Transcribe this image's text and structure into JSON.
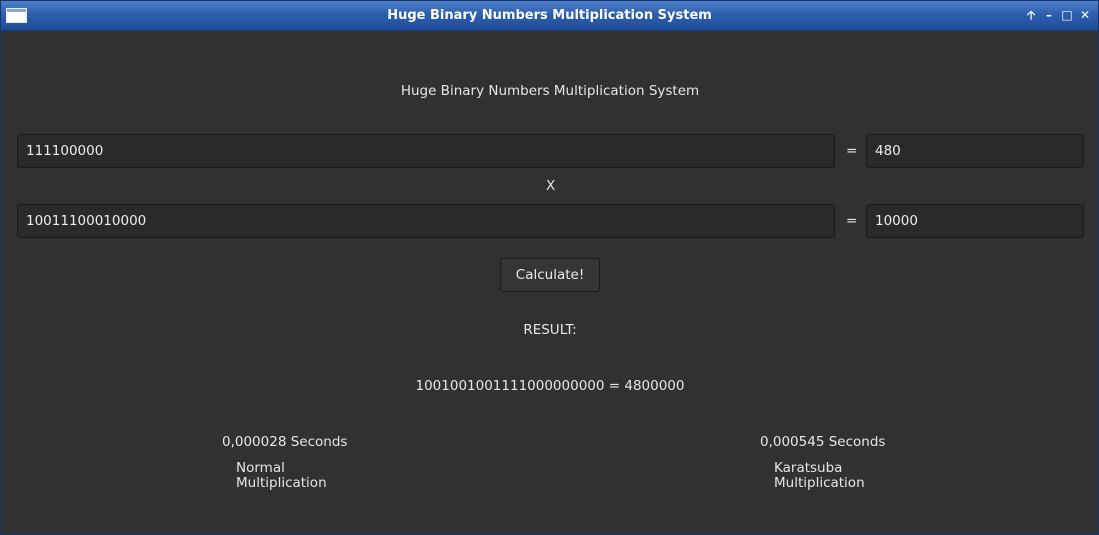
{
  "window": {
    "title": "Huge Binary Numbers Multiplication System",
    "controls": {
      "pin": "🡡",
      "minimize": "–",
      "maximize": "□",
      "close": "✕"
    }
  },
  "header": {
    "title": "Huge Binary Numbers Multiplication System"
  },
  "operands": {
    "first_binary": "111100000",
    "first_equals": "=",
    "first_decimal": "480",
    "times": "X",
    "second_binary": "10011100010000",
    "second_equals": "=",
    "second_decimal": "10000"
  },
  "actions": {
    "calculate_label": "Calculate!"
  },
  "result": {
    "heading": "RESULT:",
    "value": "1001001001111000000000 = 4800000"
  },
  "timings": {
    "normal": {
      "time": "0,000028 Seconds",
      "label_line1": "Normal",
      "label_line2": "Multiplication"
    },
    "karatsuba": {
      "time": "0,000545 Seconds",
      "label_line1": "Karatsuba",
      "label_line2": "Multiplication"
    }
  }
}
